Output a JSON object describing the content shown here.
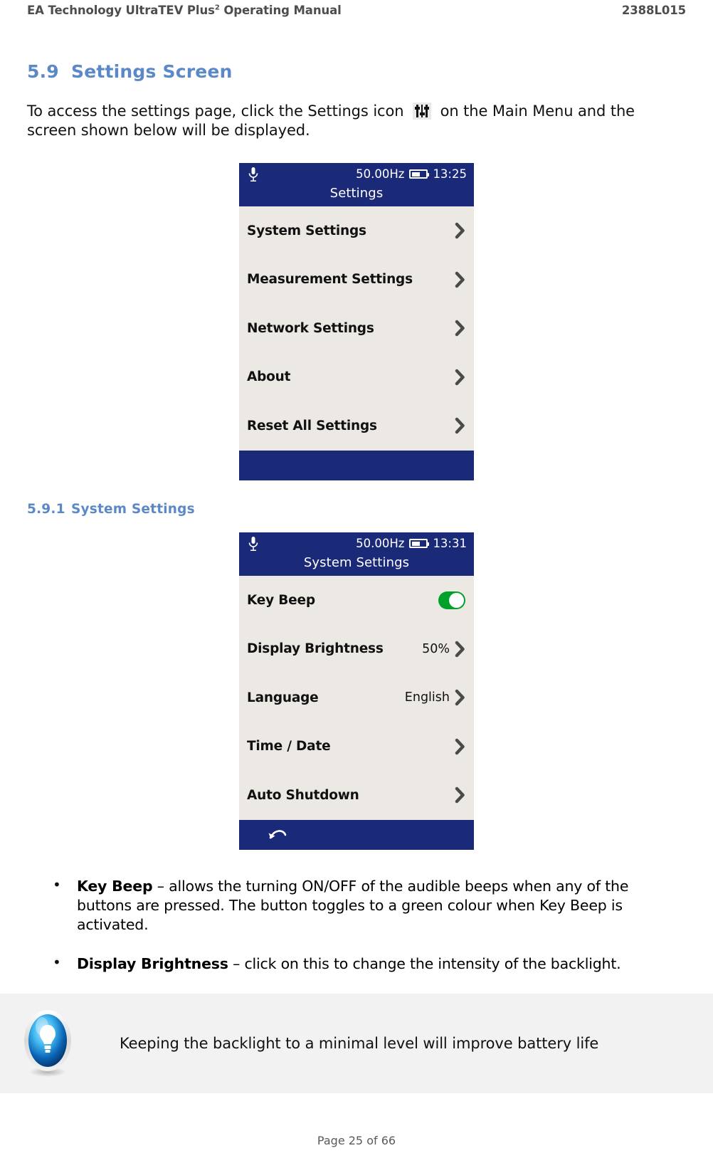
{
  "header": {
    "left_main": "EA Technology UltraTEV Plus",
    "left_sup": "2",
    "left_tail": " Operating Manual",
    "right": "2388L015"
  },
  "section": {
    "number": "5.9",
    "title": "Settings Screen",
    "intro_part1": "To access the settings page, click the Settings icon",
    "settings_icon_name": "settings-sliders-icon",
    "intro_part2": "on the Main Menu and the screen shown below will be displayed."
  },
  "settings_screen": {
    "statusbar": {
      "mic_icon": "microphone-icon",
      "frequency": "50.00Hz",
      "battery_icon": "battery-icon",
      "time": "13:25"
    },
    "title": "Settings",
    "rows": [
      {
        "label": "System Settings",
        "value": "",
        "control": "chevron"
      },
      {
        "label": "Measurement Settings",
        "value": "",
        "control": "chevron"
      },
      {
        "label": "Network Settings",
        "value": "",
        "control": "chevron"
      },
      {
        "label": "About",
        "value": "",
        "control": "chevron"
      },
      {
        "label": "Reset All Settings",
        "value": "",
        "control": "chevron"
      }
    ],
    "footer_icon": ""
  },
  "subsection": {
    "number": "5.9.1",
    "title": "System Settings"
  },
  "system_settings_screen": {
    "statusbar": {
      "mic_icon": "microphone-icon",
      "frequency": "50.00Hz",
      "battery_icon": "battery-icon",
      "time": "13:31"
    },
    "title": "System Settings",
    "rows": [
      {
        "label": "Key Beep",
        "value": "",
        "control": "toggle-on"
      },
      {
        "label": "Display Brightness",
        "value": "50%",
        "control": "chevron"
      },
      {
        "label": "Language",
        "value": "English",
        "control": "chevron"
      },
      {
        "label": "Time / Date",
        "value": "",
        "control": "chevron"
      },
      {
        "label": "Auto Shutdown",
        "value": "",
        "control": "chevron"
      }
    ],
    "footer_icon": "back-arrow-icon"
  },
  "bullets": [
    {
      "term": "Key Beep",
      "text": " – allows the turning ON/OFF of the audible beeps when any of the buttons are pressed. The button toggles to a green colour when Key Beep is activated."
    },
    {
      "term": "Display Brightness",
      "text": " – click on this to change the intensity of the backlight."
    }
  ],
  "tip": {
    "icon": "lightbulb-icon",
    "text": "Keeping the backlight to a minimal level will improve battery life"
  },
  "footer": {
    "page_label": "Page 25 of 66"
  },
  "colors": {
    "heading_blue": "#5b89c8",
    "device_navy": "#1b2a78",
    "device_panel": "#ece9e4",
    "toggle_green": "#00a12b",
    "chevron_gray": "#4a4a4a",
    "tip_bg": "#f2f2f2"
  }
}
